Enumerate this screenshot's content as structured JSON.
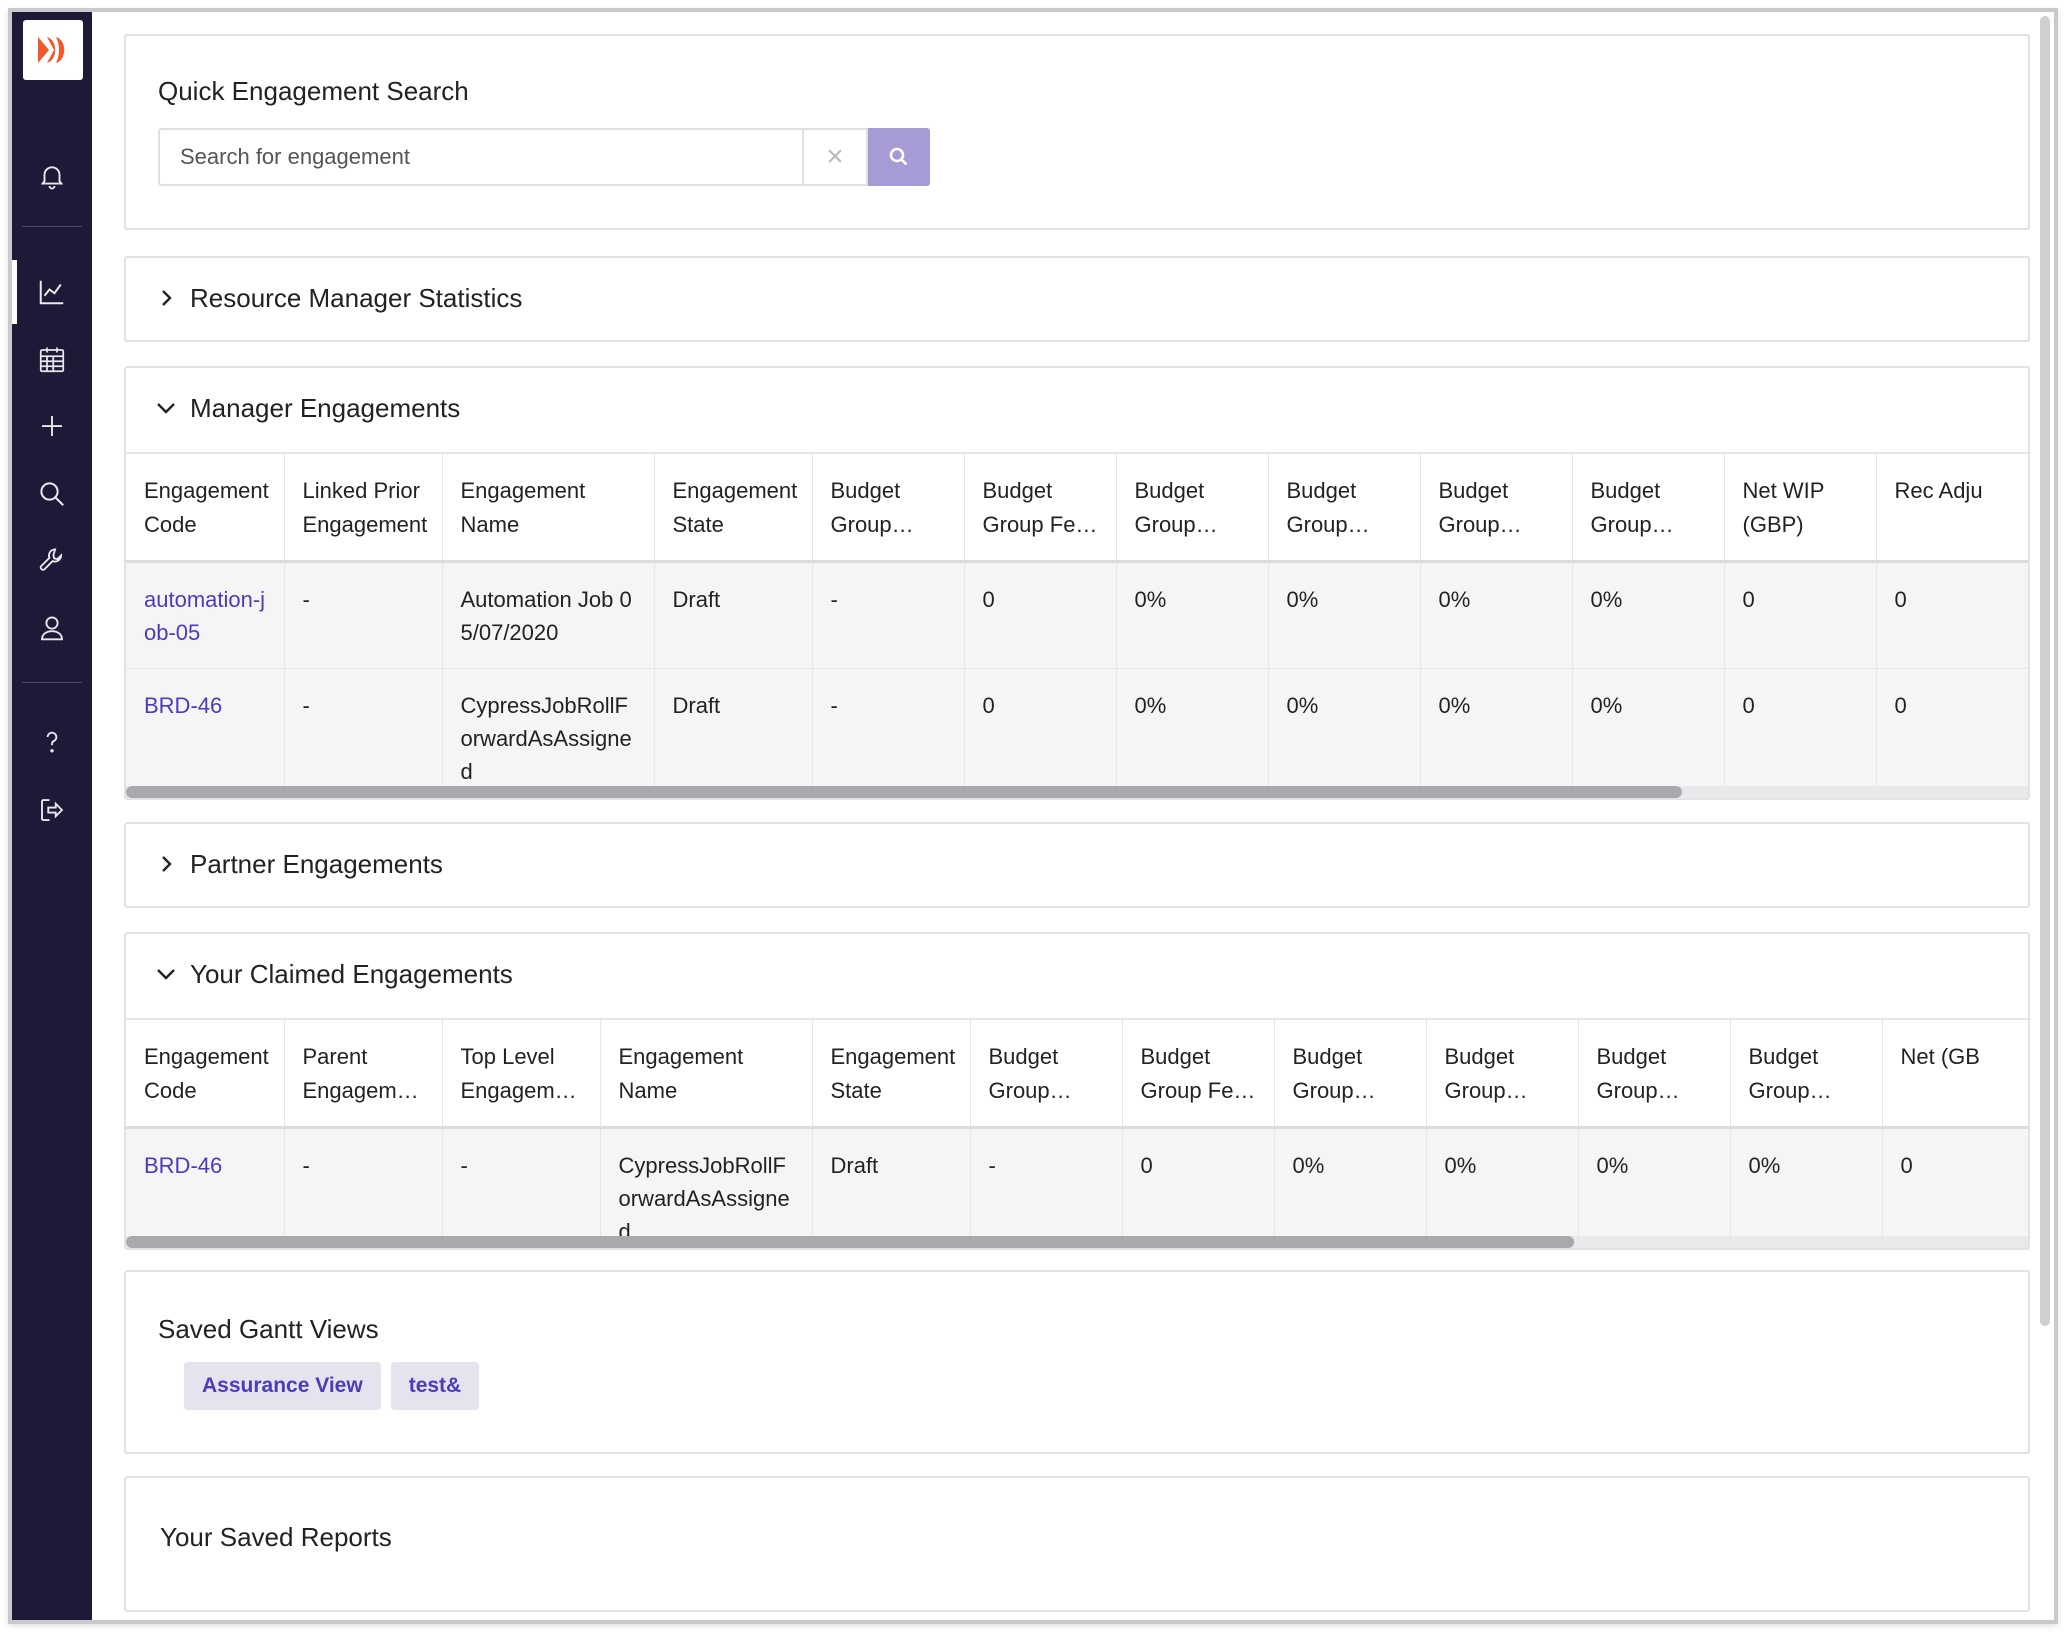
{
  "sidebar": {
    "logo": "brand-logo",
    "icons": [
      "bell-icon",
      "chart-icon",
      "calendar-icon",
      "plus-icon",
      "search-icon",
      "wrench-icon",
      "user-icon",
      "help-icon",
      "logout-icon"
    ]
  },
  "quick_search": {
    "title": "Quick Engagement Search",
    "placeholder": "Search for engagement",
    "clear": "×"
  },
  "resource_stats": {
    "title": "Resource Manager Statistics"
  },
  "manager_engagements": {
    "title": "Manager Engagements",
    "headers": [
      "Engagement Code",
      "Linked Prior Engagement",
      "Engagement Name",
      "Engagement State",
      "Budget Group…",
      "Budget Group Fe…",
      "Budget Group…",
      "Budget Group…",
      "Budget Group…",
      "Budget Group…",
      "Net WIP (GBP)",
      "Rec Adju"
    ],
    "rows": [
      [
        "automation-job-05",
        "-",
        "Automation Job 05/07/2020",
        "Draft",
        "-",
        "0",
        "0%",
        "0%",
        "0%",
        "0%",
        "0",
        "0"
      ],
      [
        "BRD-46",
        "-",
        "CypressJobRollForwardAsAssigned",
        "Draft",
        "-",
        "0",
        "0%",
        "0%",
        "0%",
        "0%",
        "0",
        "0"
      ]
    ]
  },
  "partner_engagements": {
    "title": "Partner Engagements"
  },
  "claimed_engagements": {
    "title": "Your Claimed Engagements",
    "headers": [
      "Engagement Code",
      "Parent Engagem…",
      "Top Level Engagem…",
      "Engagement Name",
      "Engagement State",
      "Budget Group…",
      "Budget Group Fe…",
      "Budget Group…",
      "Budget Group…",
      "Budget Group…",
      "Budget Group…",
      "Net (GB"
    ],
    "rows": [
      [
        "BRD-46",
        "-",
        "-",
        "CypressJobRollForwardAsAssigned",
        "Draft",
        "-",
        "0",
        "0%",
        "0%",
        "0%",
        "0%",
        "0"
      ]
    ]
  },
  "saved_gantt": {
    "title": "Saved Gantt Views",
    "views": [
      "Assurance View",
      "test&"
    ]
  },
  "saved_reports": {
    "title": "Your Saved Reports"
  },
  "colors": {
    "sidebar": "#1c1a36",
    "accent": "#4b3bbd",
    "search_button": "#a79bd6",
    "logo_mark": "#f05a28"
  }
}
